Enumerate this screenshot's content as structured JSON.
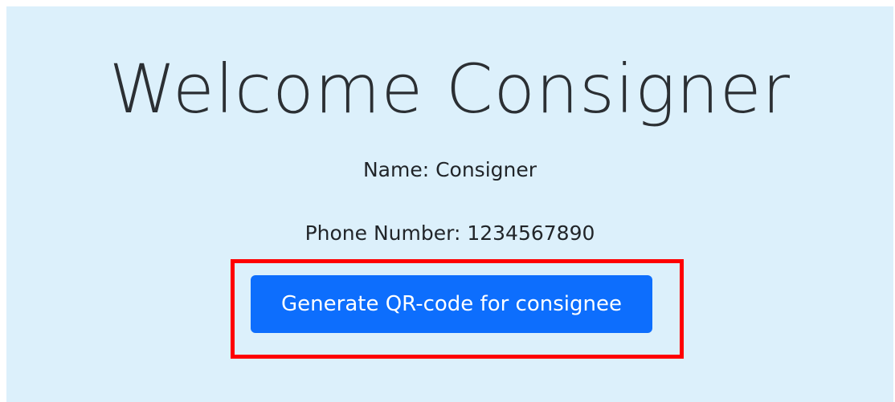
{
  "page": {
    "title": "Welcome Consigner",
    "name_line": "Name: Consigner",
    "phone_line": "Phone Number: 1234567890"
  },
  "actions": {
    "generate_qr_label": "Generate QR-code for consignee"
  },
  "colors": {
    "background": "#dcf0fb",
    "button": "#0d6efd",
    "highlight": "#ff0000",
    "text": "#212529"
  }
}
